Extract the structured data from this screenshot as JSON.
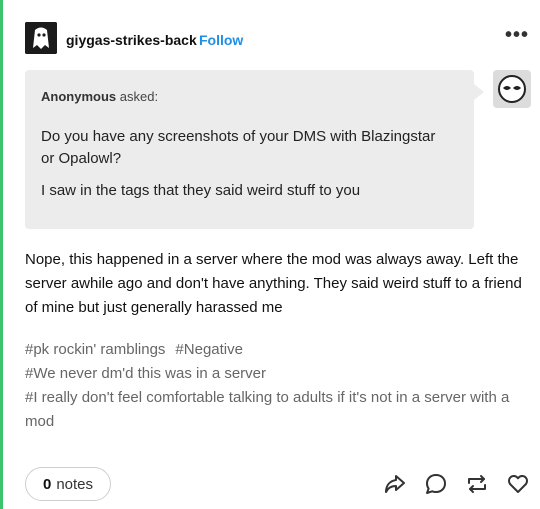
{
  "header": {
    "username": "giygas-strikes-back",
    "follow_label": "Follow",
    "more_label": "•••"
  },
  "ask": {
    "asker_name": "Anonymous",
    "asked_label": "asked:",
    "question_lines": [
      "Do you have any screenshots of your DMS with Blazingstar or Opalowl?",
      "I saw in the tags that they said weird stuff to you"
    ]
  },
  "answer": {
    "text": "Nope, this happened in a server where the mod was always away. Left the server awhile ago and don't have anything. They said weird stuff to a friend of mine but just generally harassed me"
  },
  "tags": [
    "#pk rockin' ramblings",
    "#Negative",
    "#We never dm'd this was in a server",
    "#I really don't feel comfortable talking to adults if it's not in a server with a mod"
  ],
  "footer": {
    "notes_count": "0",
    "notes_label": "notes"
  },
  "colors": {
    "accent_follow": "#1f8fe6",
    "border": "#3ec46d",
    "ask_bg": "#ececec"
  },
  "icons": [
    "share-icon",
    "reply-icon",
    "reblog-icon",
    "like-icon"
  ]
}
